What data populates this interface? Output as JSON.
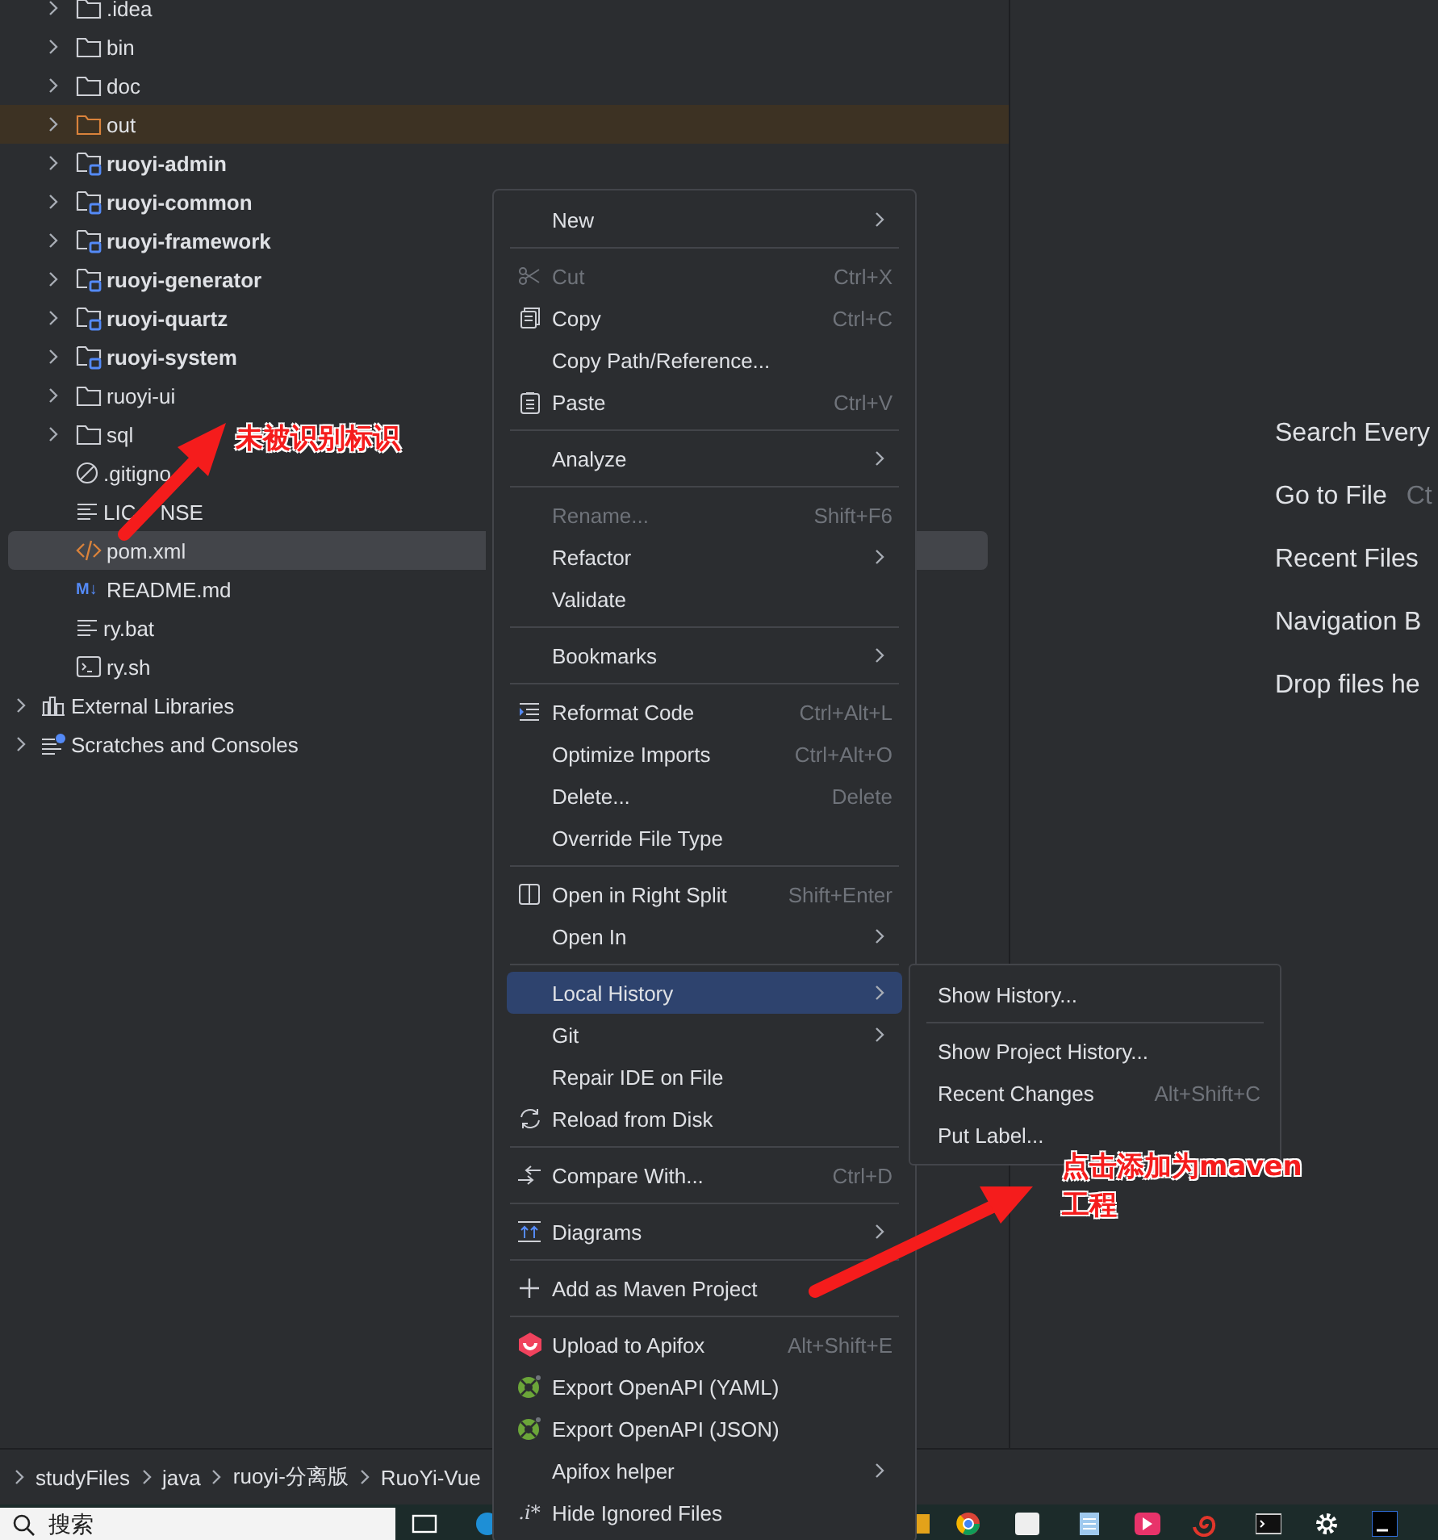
{
  "project_tree": [
    {
      "label": ".idea",
      "kind": "folder",
      "bold": false,
      "excluded": false,
      "expandable": true,
      "selected": false
    },
    {
      "label": "bin",
      "kind": "folder",
      "bold": false,
      "excluded": false,
      "expandable": true,
      "selected": false
    },
    {
      "label": "doc",
      "kind": "folder",
      "bold": false,
      "excluded": false,
      "expandable": true,
      "selected": false
    },
    {
      "label": "out",
      "kind": "folder",
      "bold": false,
      "excluded": true,
      "expandable": true,
      "selected": false
    },
    {
      "label": "ruoyi-admin",
      "kind": "module",
      "bold": true,
      "excluded": false,
      "expandable": true,
      "selected": false
    },
    {
      "label": "ruoyi-common",
      "kind": "module",
      "bold": true,
      "excluded": false,
      "expandable": true,
      "selected": false
    },
    {
      "label": "ruoyi-framework",
      "kind": "module",
      "bold": true,
      "excluded": false,
      "expandable": true,
      "selected": false
    },
    {
      "label": "ruoyi-generator",
      "kind": "module",
      "bold": true,
      "excluded": false,
      "expandable": true,
      "selected": false
    },
    {
      "label": "ruoyi-quartz",
      "kind": "module",
      "bold": true,
      "excluded": false,
      "expandable": true,
      "selected": false
    },
    {
      "label": "ruoyi-system",
      "kind": "module",
      "bold": true,
      "excluded": false,
      "expandable": true,
      "selected": false
    },
    {
      "label": "ruoyi-ui",
      "kind": "folder",
      "bold": false,
      "excluded": false,
      "expandable": true,
      "selected": false
    },
    {
      "label": "sql",
      "kind": "folder",
      "bold": false,
      "excluded": false,
      "expandable": true,
      "selected": false
    },
    {
      "label": ".gitigno",
      "kind": "ignore",
      "bold": false,
      "excluded": false,
      "expandable": false,
      "selected": false
    },
    {
      "label": "LIC",
      "label_tail": "NSE",
      "kind": "text",
      "bold": false,
      "excluded": false,
      "expandable": false,
      "selected": false
    },
    {
      "label": "pom.xml",
      "kind": "xml",
      "bold": false,
      "excluded": false,
      "expandable": false,
      "selected": true
    },
    {
      "label": "README.md",
      "kind": "markdown",
      "icon_text": "M↓",
      "bold": false,
      "excluded": false,
      "expandable": false,
      "selected": false
    },
    {
      "label": "ry.bat",
      "kind": "text",
      "bold": false,
      "excluded": false,
      "expandable": false,
      "selected": false
    },
    {
      "label": "ry.sh",
      "kind": "terminal",
      "bold": false,
      "excluded": false,
      "expandable": false,
      "selected": false
    }
  ],
  "top_tree": [
    {
      "label": "External Libraries",
      "kind": "library",
      "expandable": true
    },
    {
      "label": "Scratches and Consoles",
      "kind": "scratches",
      "expandable": true
    }
  ],
  "editor_hints": [
    {
      "label": "Search Every"
    },
    {
      "label": "Go to File",
      "shortcut": "Ct"
    },
    {
      "label": "Recent Files"
    },
    {
      "label": "Navigation B"
    },
    {
      "label": "Drop files he"
    }
  ],
  "breadcrumb": [
    "studyFiles",
    "java",
    "ruoyi-分离版",
    "RuoYi-Vue"
  ],
  "taskbar": {
    "search_placeholder": "搜索"
  },
  "context_menu": [
    {
      "kind": "plain",
      "label": "New",
      "submenu": true,
      "disabled": false,
      "selected": false
    },
    {
      "kind": "separator"
    },
    {
      "kind": "scissors",
      "label": "Cut",
      "shortcut": "Ctrl+X",
      "submenu": false,
      "disabled": true,
      "selected": false
    },
    {
      "kind": "copy",
      "label": "Copy",
      "shortcut": "Ctrl+C",
      "submenu": false,
      "disabled": false,
      "selected": false
    },
    {
      "kind": "plain",
      "label": "Copy Path/Reference...",
      "submenu": false,
      "disabled": false,
      "selected": false
    },
    {
      "kind": "paste",
      "label": "Paste",
      "shortcut": "Ctrl+V",
      "submenu": false,
      "disabled": false,
      "selected": false
    },
    {
      "kind": "separator"
    },
    {
      "kind": "plain",
      "label": "Analyze",
      "submenu": true,
      "disabled": false,
      "selected": false
    },
    {
      "kind": "separator"
    },
    {
      "kind": "plain",
      "label": "Rename...",
      "shortcut": "Shift+F6",
      "submenu": false,
      "disabled": true,
      "selected": false
    },
    {
      "kind": "plain",
      "label": "Refactor",
      "submenu": true,
      "disabled": false,
      "selected": false
    },
    {
      "kind": "plain",
      "label": "Validate",
      "submenu": false,
      "disabled": false,
      "selected": false
    },
    {
      "kind": "separator"
    },
    {
      "kind": "plain",
      "label": "Bookmarks",
      "submenu": true,
      "disabled": false,
      "selected": false
    },
    {
      "kind": "separator"
    },
    {
      "kind": "reformat",
      "label": "Reformat Code",
      "shortcut": "Ctrl+Alt+L",
      "submenu": false,
      "disabled": false,
      "selected": false
    },
    {
      "kind": "plain",
      "label": "Optimize Imports",
      "shortcut": "Ctrl+Alt+O",
      "submenu": false,
      "disabled": false,
      "selected": false
    },
    {
      "kind": "plain",
      "label": "Delete...",
      "shortcut": "Delete",
      "submenu": false,
      "disabled": false,
      "selected": false
    },
    {
      "kind": "plain",
      "label": "Override File Type",
      "submenu": false,
      "disabled": false,
      "selected": false
    },
    {
      "kind": "separator"
    },
    {
      "kind": "split",
      "label": "Open in Right Split",
      "shortcut": "Shift+Enter",
      "submenu": false,
      "disabled": false,
      "selected": false
    },
    {
      "kind": "plain",
      "label": "Open In",
      "submenu": true,
      "disabled": false,
      "selected": false
    },
    {
      "kind": "separator"
    },
    {
      "kind": "plain",
      "label": "Local History",
      "submenu": true,
      "disabled": false,
      "selected": true
    },
    {
      "kind": "plain",
      "label": "Git",
      "submenu": true,
      "disabled": false,
      "selected": false
    },
    {
      "kind": "plain",
      "label": "Repair IDE on File",
      "submenu": false,
      "disabled": false,
      "selected": false
    },
    {
      "kind": "reload",
      "label": "Reload from Disk",
      "submenu": false,
      "disabled": false,
      "selected": false
    },
    {
      "kind": "separator"
    },
    {
      "kind": "compare",
      "label": "Compare With...",
      "shortcut": "Ctrl+D",
      "submenu": false,
      "disabled": false,
      "selected": false
    },
    {
      "kind": "separator"
    },
    {
      "kind": "diagrams",
      "label": "Diagrams",
      "submenu": true,
      "disabled": false,
      "selected": false
    },
    {
      "kind": "separator"
    },
    {
      "kind": "plus",
      "label": "Add as Maven Project",
      "submenu": false,
      "disabled": false,
      "selected": false
    },
    {
      "kind": "separator"
    },
    {
      "kind": "apifox",
      "label": "Upload to Apifox",
      "shortcut": "Alt+Shift+E",
      "submenu": false,
      "disabled": false,
      "selected": false
    },
    {
      "kind": "openapi",
      "label": "Export OpenAPI (YAML)",
      "submenu": false,
      "disabled": false,
      "selected": false
    },
    {
      "kind": "openapi",
      "label": "Export OpenAPI (JSON)",
      "submenu": false,
      "disabled": false,
      "selected": false
    },
    {
      "kind": "plain",
      "label": "Apifox helper",
      "submenu": true,
      "disabled": false,
      "selected": false
    },
    {
      "kind": "glyph",
      "label": "Hide Ignored Files",
      "icon_text": ".i*",
      "submenu": false,
      "disabled": false,
      "selected": false
    }
  ],
  "submenu": [
    {
      "kind": "item",
      "label": "Show History..."
    },
    {
      "kind": "separator"
    },
    {
      "kind": "item",
      "label": "Show Project History..."
    },
    {
      "kind": "item",
      "label": "Recent Changes",
      "shortcut": "Alt+Shift+C"
    },
    {
      "kind": "item",
      "label": "Put Label..."
    }
  ],
  "annotations": [
    {
      "lines": [
        "未被识别标识"
      ]
    },
    {
      "lines": [
        "点击添加为maven",
        "工程"
      ]
    }
  ]
}
